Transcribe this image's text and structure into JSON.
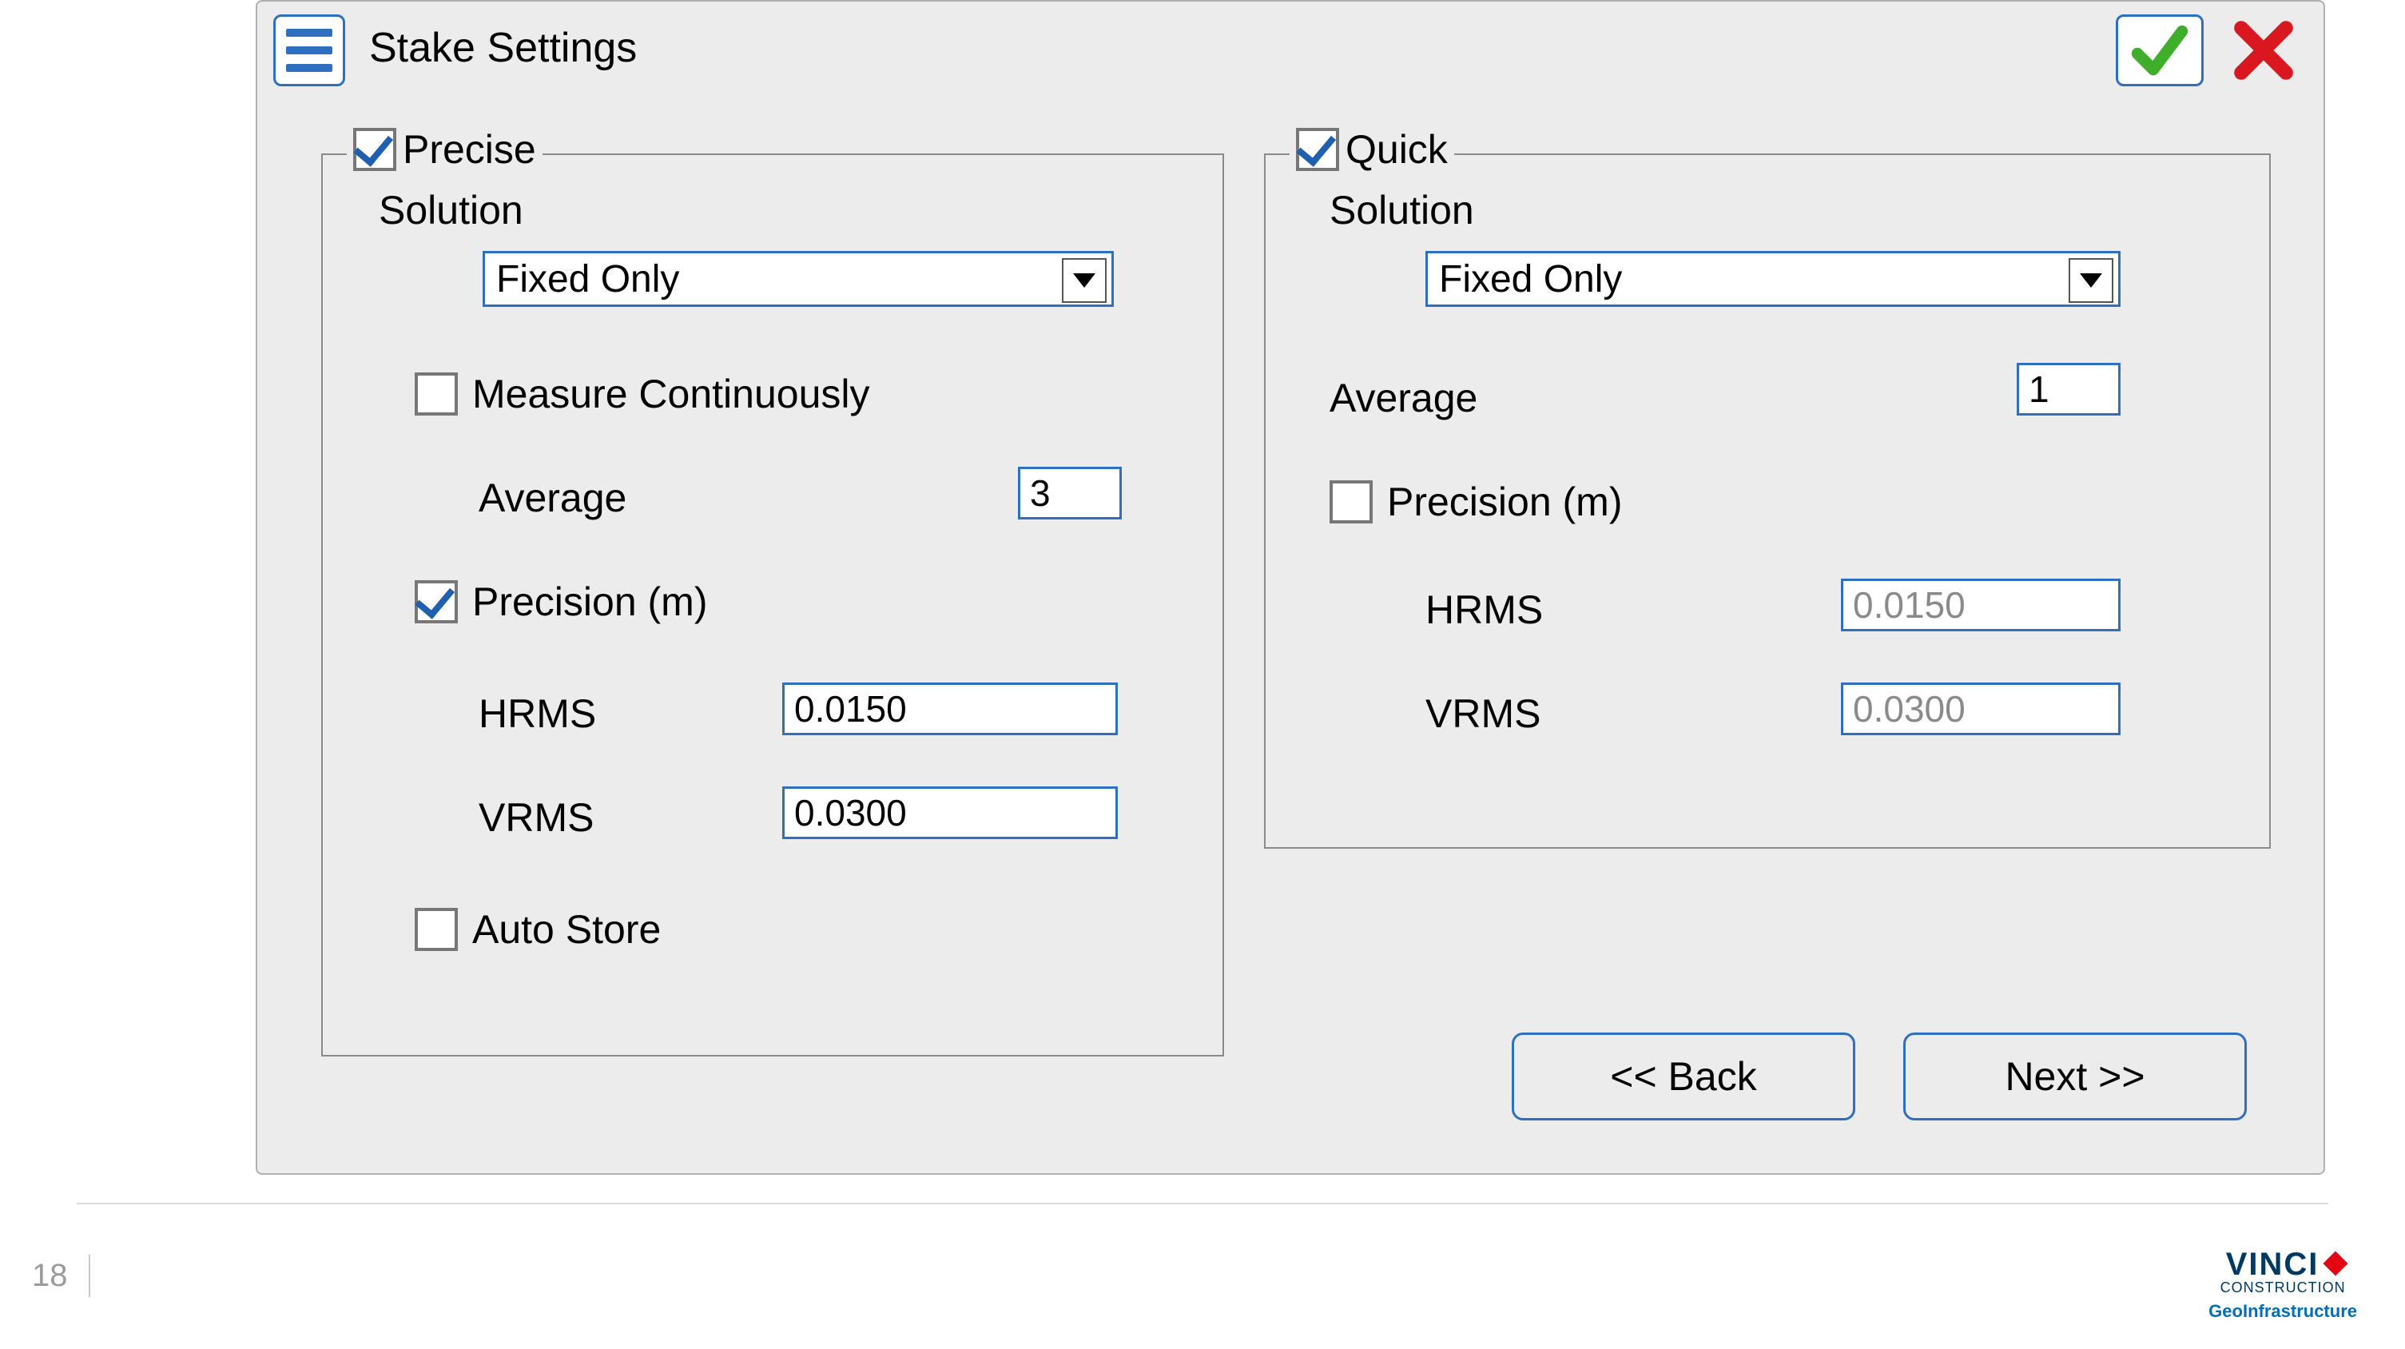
{
  "dialog": {
    "title": "Stake Settings"
  },
  "precise": {
    "legend": "Precise",
    "checked": true,
    "solution_label": "Solution",
    "solution_value": "Fixed Only",
    "measure_cont_label": "Measure Continuously",
    "measure_cont_checked": false,
    "average_label": "Average",
    "average_value": "3",
    "precision_label": "Precision (m)",
    "precision_checked": true,
    "hrms_label": "HRMS",
    "hrms_value": "0.0150",
    "vrms_label": "VRMS",
    "vrms_value": "0.0300",
    "auto_store_label": "Auto Store",
    "auto_store_checked": false
  },
  "quick": {
    "legend": "Quick",
    "checked": true,
    "solution_label": "Solution",
    "solution_value": "Fixed Only",
    "average_label": "Average",
    "average_value": "1",
    "precision_label": "Precision (m)",
    "precision_checked": false,
    "hrms_label": "HRMS",
    "hrms_value": "0.0150",
    "vrms_label": "VRMS",
    "vrms_value": "0.0300"
  },
  "nav": {
    "back": "<<  Back",
    "next": "Next  >>"
  },
  "footer": {
    "page": "18",
    "brand_word": "VINCI",
    "brand_sub1": "CONSTRUCTION",
    "brand_sub2": "GeoInfrastructure"
  }
}
